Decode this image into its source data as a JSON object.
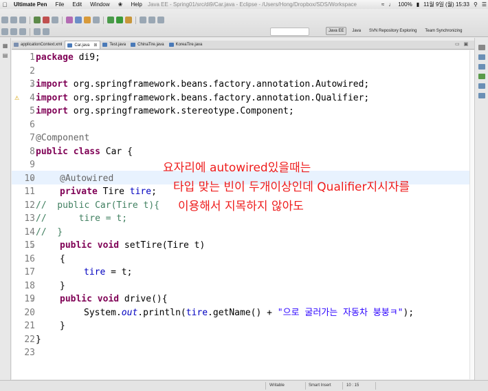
{
  "menubar": {
    "apple": "",
    "app_name": "Ultimate Pen",
    "items": [
      "File",
      "Edit",
      "Window",
      "Help"
    ],
    "window_title": "Java EE - Spring01/src/di9/Car.java - Eclipse - /Users/Hong/Dropbox/SDS/Workspace",
    "battery": "100%",
    "datetime": "11월 9일 (월)  15:33"
  },
  "perspectives": [
    "Java EE",
    "Java",
    "SVN Repository Exploring",
    "Team Synchronizing"
  ],
  "tabs": [
    {
      "label": "applicationContext.xml",
      "active": false
    },
    {
      "label": "Car.java",
      "active": true,
      "close": "⊠"
    },
    {
      "label": "Test.java",
      "active": false
    },
    {
      "label": "ChinaTire.java",
      "active": false
    },
    {
      "label": "KoreaTire.java",
      "active": false
    }
  ],
  "tab_controls": [
    "▭",
    "▣"
  ],
  "editor": {
    "line_numbers": [
      "1",
      "2",
      "3",
      "4",
      "5",
      "6",
      "7",
      "8",
      "9",
      "10",
      "11",
      "12",
      "13",
      "14",
      "15",
      "16",
      "17",
      "18",
      "19",
      "20",
      "21",
      "22",
      "23"
    ],
    "current_line": 10,
    "code": {
      "l1_kw": "package",
      "l1_rest": " di9;",
      "l3_kw": "import",
      "l3_rest": " org.springframework.beans.factory.annotation.Autowired;",
      "l4_kw": "import",
      "l4_rest": " org.springframework.beans.factory.annotation.Qualifier;",
      "l5_kw": "import",
      "l5_rest": " org.springframework.stereotype.Component;",
      "l7": "@Component",
      "l8_kw1": "public",
      "l8_kw2": "class",
      "l8_rest": " Car {",
      "l10": "@Autowired",
      "l11_kw": "private",
      "l11_rest": " Tire ",
      "l11_fld": "tire",
      "l11_end": ";",
      "l12": "//  public Car(Tire t){",
      "l13": "//      tire = t;",
      "l14": "//  }",
      "l15_kw1": "public",
      "l15_kw2": "void",
      "l15_rest": " setTire(Tire t)",
      "l16": "{",
      "l17_fld": "tire",
      "l17_rest": " = t;",
      "l18": "}",
      "l19_kw1": "public",
      "l19_kw2": "void",
      "l19_rest": " drive(){",
      "l20_a": "System.",
      "l20_out": "out",
      "l20_b": ".println(",
      "l20_fld": "tire",
      "l20_c": ".getName() + ",
      "l20_str": "\"으로 굴러가는 자동차 붕붕ㅋ\"",
      "l20_d": ");",
      "l21": "}",
      "l22": "}"
    }
  },
  "annotation": {
    "line1": "요자리에 autowired있을때는",
    "line2": "타입 맞는 빈이 두개이상인데 Qualifier지시자를",
    "line3": "이용해서 지목하지 않아도",
    "color": "#ee1c1c"
  },
  "statusbar": {
    "mode": "Writable",
    "insert": "Smart Insert",
    "position": "10 : 15"
  }
}
